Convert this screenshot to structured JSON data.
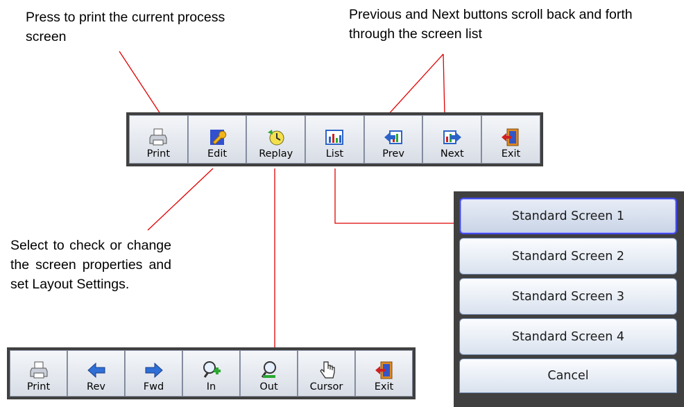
{
  "annotations": {
    "print_note": "Press to print the current process screen",
    "prev_next_note": "Previous and Next buttons scroll back and forth through the screen list",
    "edit_note": "Select to check or change the screen properties and set Layout Settings."
  },
  "process_toolbar": {
    "buttons": [
      {
        "label": "Print",
        "icon": "printer-icon"
      },
      {
        "label": "Edit",
        "icon": "wrench-icon"
      },
      {
        "label": "Replay",
        "icon": "replay-clock-icon"
      },
      {
        "label": "List",
        "icon": "screen-list-icon"
      },
      {
        "label": "Prev",
        "icon": "previous-screen-icon"
      },
      {
        "label": "Next",
        "icon": "next-screen-icon"
      },
      {
        "label": "Exit",
        "icon": "exit-door-icon"
      }
    ]
  },
  "replay_toolbar": {
    "buttons": [
      {
        "label": "Print",
        "icon": "printer-icon"
      },
      {
        "label": "Rev",
        "icon": "arrow-left-icon"
      },
      {
        "label": "Fwd",
        "icon": "arrow-right-icon"
      },
      {
        "label": "In",
        "icon": "zoom-in-icon"
      },
      {
        "label": "Out",
        "icon": "zoom-out-icon"
      },
      {
        "label": "Cursor",
        "icon": "hand-cursor-icon"
      },
      {
        "label": "Exit",
        "icon": "exit-door-icon"
      }
    ]
  },
  "screen_list": {
    "items": [
      "Standard Screen 1",
      "Standard Screen 2",
      "Standard Screen 3",
      "Standard Screen 4"
    ],
    "selected": "Standard Screen 1",
    "cancel_label": "Cancel"
  },
  "colors": {
    "callout_line": "#e00000",
    "toolbar_frame": "#404040",
    "selected_border": "#4047e6"
  }
}
